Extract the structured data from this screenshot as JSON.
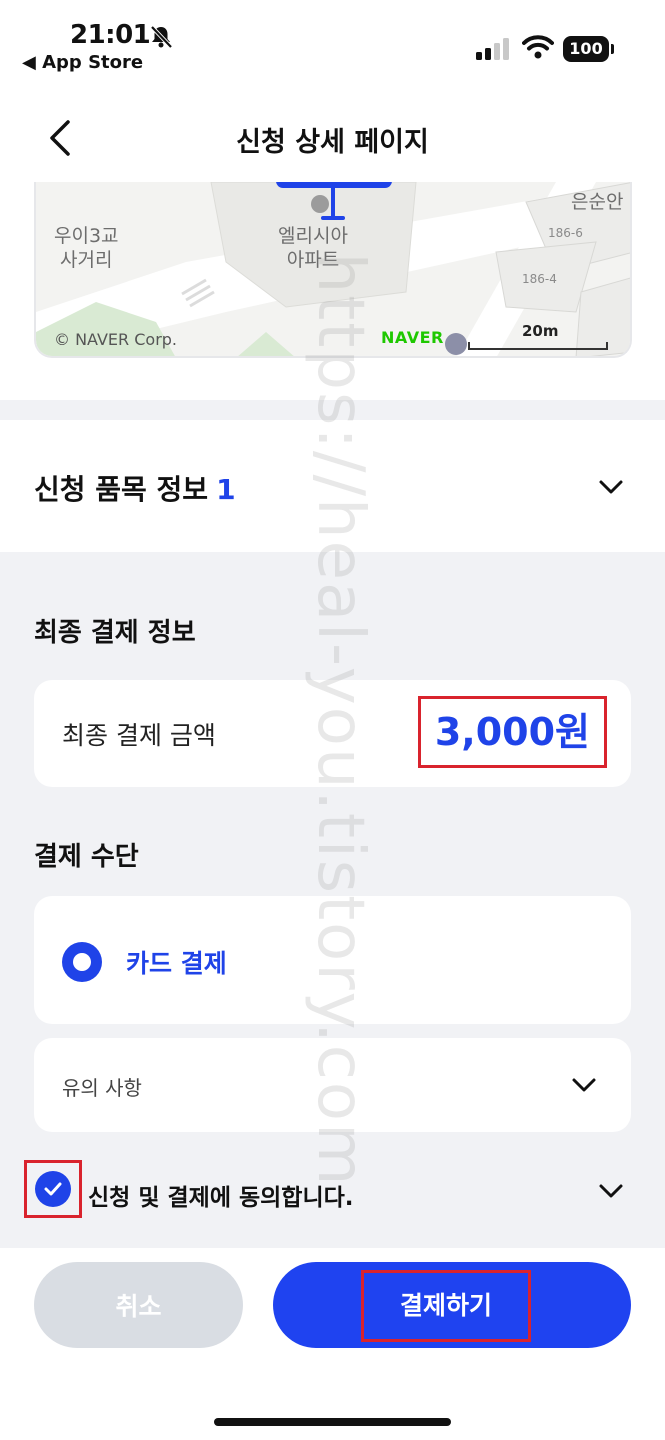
{
  "status_bar": {
    "time": "21:01",
    "back_app": "◀ App Store",
    "battery": "100"
  },
  "header": {
    "title": "신청 상세 페이지"
  },
  "map": {
    "labels": {
      "intersection_line1": "우이3교",
      "intersection_line2": "사거리",
      "apartment_line1": "엘리시아",
      "apartment_line2": "아파트",
      "corner": "은순안",
      "parcel_1": "186-6",
      "parcel_2": "186-4"
    },
    "copyright": "© NAVER Corp.",
    "brand": "NAVER",
    "scale": "20m"
  },
  "items": {
    "title": "신청 품목 정보",
    "count": "1"
  },
  "final_payment": {
    "section_title": "최종 결제 정보",
    "amount_label": "최종 결제 금액",
    "amount_value": "3,000원"
  },
  "payment_method": {
    "section_title": "결제 수단",
    "selected": "카드 결제",
    "notes_label": "유의 사항"
  },
  "agreement": {
    "label": "신청 및 결제에 동의합니다.",
    "checked": true
  },
  "buttons": {
    "cancel": "취소",
    "pay": "결제하기"
  },
  "watermark": "https://heal-you.tistory.com",
  "colors": {
    "accent": "#1f43e8",
    "highlight_border": "#d9232d",
    "background_gray": "#f1f2f5",
    "cancel_gray": "#d9dde3"
  }
}
